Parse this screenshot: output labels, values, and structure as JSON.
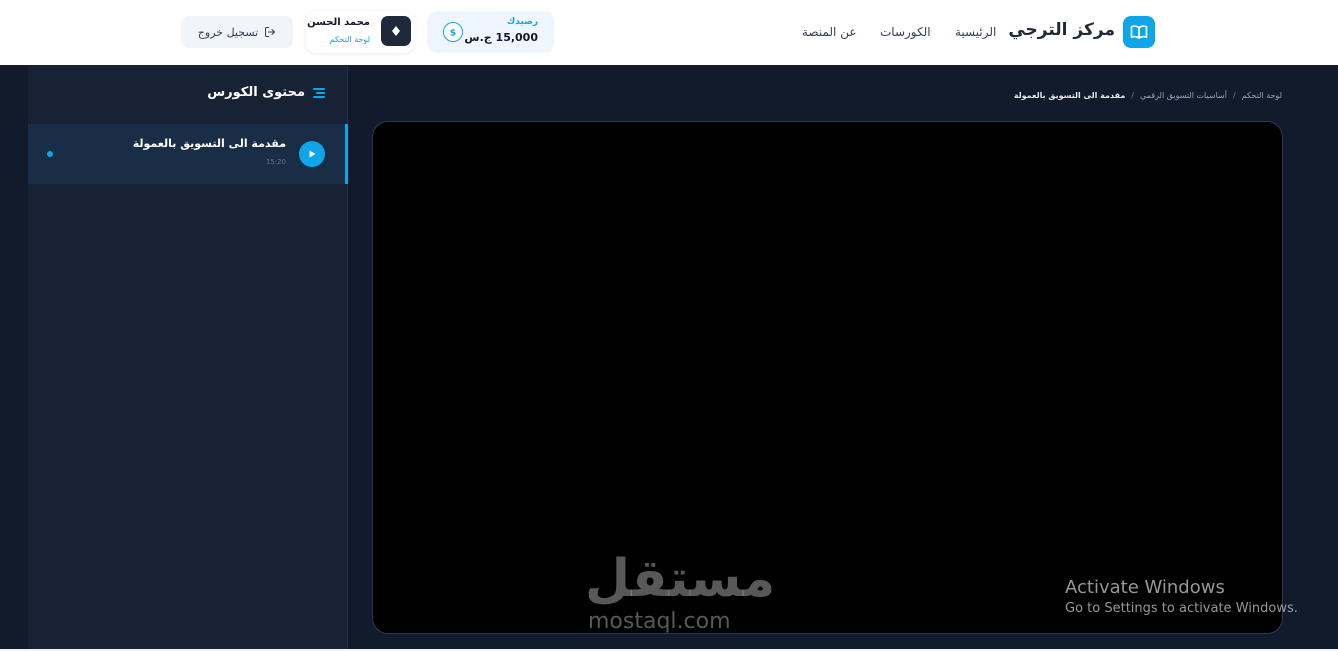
{
  "header": {
    "brand": "مركز الترجي",
    "nav": [
      "الرئيسية",
      "الكورسات",
      "عن المنصة"
    ],
    "balance_label": "رصيدك",
    "balance_value": "15,000 ج.س",
    "user_name": "محمد الحسن",
    "user_link": "لوحة التحكم",
    "logout_label": "تسجيل خروج"
  },
  "sidebar": {
    "title": "محتوى الكورس",
    "lessons": [
      {
        "title": "مقدمة الى التسويق بالعمولة",
        "duration": "15:20"
      }
    ]
  },
  "breadcrumb": {
    "items": [
      "لوحة التحكم",
      "أساسيات التسويق الرقمي",
      "مقدمة الى التسويق بالعمولة"
    ],
    "separator": "/"
  },
  "watermark": {
    "arabic": "مستقل",
    "latin": "mostaql.com"
  },
  "os_notice": {
    "title": "Activate Windows",
    "subtitle": "Go to Settings to activate Windows."
  },
  "colors": {
    "accent": "#0ea5e9",
    "dark_bg": "#121b2c",
    "sidebar_bg": "#172235"
  }
}
